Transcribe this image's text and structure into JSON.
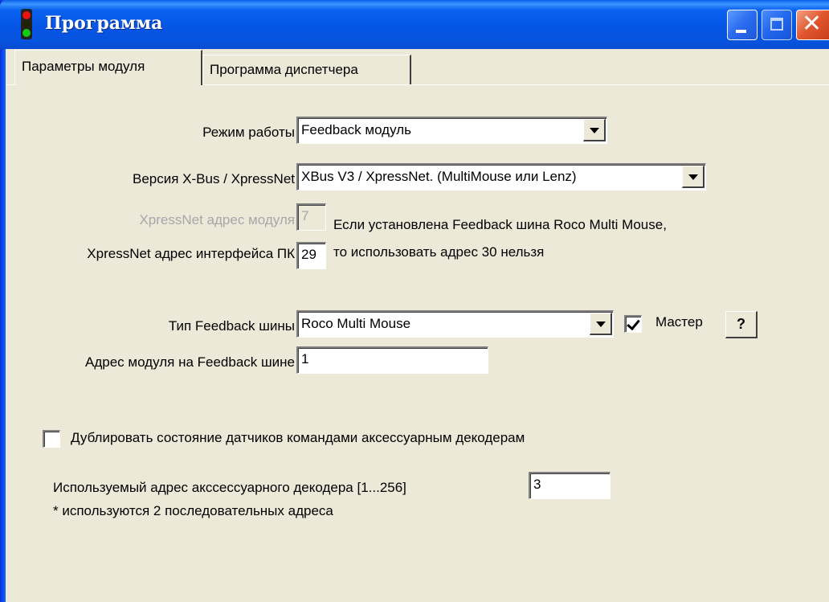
{
  "window": {
    "title": "Программа",
    "icon": "traffic-light-icon"
  },
  "tabs": [
    {
      "label": "Параметры модуля",
      "active": true
    },
    {
      "label": "Программа диспетчера",
      "active": false
    }
  ],
  "form": {
    "mode_label": "Режим работы",
    "mode_value": "Feedback модуль",
    "xbus_label": "Версия X-Bus / XpressNet",
    "xbus_value": "XBus V3 / XpressNet. (MultiMouse или Lenz)",
    "module_addr_label": "XpressNet адрес модуля",
    "module_addr_value": "7",
    "pc_addr_label": "XpressNet адрес интерфейса ПК",
    "pc_addr_value": "29",
    "note_line1": "Если установлена Feedback шина Roco Multi Mouse,",
    "note_line2": "то использовать адрес 30 нельзя",
    "feedback_type_label": "Тип Feedback шины",
    "feedback_type_value": "Roco Multi Mouse",
    "master_label": "Мастер",
    "master_checked": true,
    "help_label": "?",
    "feedback_addr_label": "Адрес модуля на Feedback шине",
    "feedback_addr_value": "1",
    "duplicate_label": "Дублировать состояние датчиков командами аксессуарным декодерам",
    "duplicate_checked": false,
    "accessory_addr_label": "Используемый адрес акссессуарного декодера [1...256]",
    "accessory_addr_value": "3",
    "accessory_note": "* используются 2 последовательных адреса"
  },
  "colors": {
    "titlebar": "#0554e4",
    "face": "#ece9d8",
    "close": "#e0552c",
    "disabled_text": "#a7a6aa"
  }
}
